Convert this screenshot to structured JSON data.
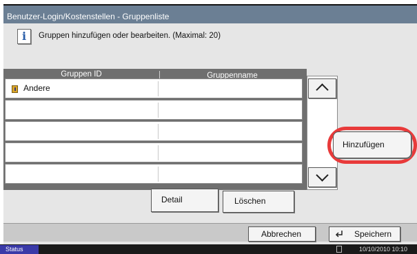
{
  "titlebar": {
    "title": "Benutzer-Login/Kostenstellen - Gruppenliste"
  },
  "info": {
    "icon": "info-icon",
    "message": "Gruppen hinzufügen oder bearbeiten. (Maximal: 20)"
  },
  "table": {
    "columns": [
      "Gruppen ID",
      "Gruppenname"
    ],
    "rows": [
      {
        "id": "Andere",
        "name": "",
        "icon": "group-icon"
      },
      {
        "id": "",
        "name": ""
      },
      {
        "id": "",
        "name": ""
      },
      {
        "id": "",
        "name": ""
      },
      {
        "id": "",
        "name": ""
      }
    ]
  },
  "scroll": {
    "up_icon": "chevron-up-icon",
    "down_icon": "chevron-down-icon"
  },
  "actions": {
    "detail": "Detail",
    "loeschen": "Löschen",
    "hinzufuegen": "Hinzufügen"
  },
  "footer": {
    "abbrechen": "Abbrechen",
    "speichern": "Speichern",
    "enter_icon": "enter-icon"
  },
  "statusbar": {
    "status": "Status",
    "datetime": "10/10/2010 10:10"
  },
  "colors": {
    "titlebar": "#6b7f94",
    "highlight": "#e83a3a",
    "status_button": "#3a3aa8"
  }
}
